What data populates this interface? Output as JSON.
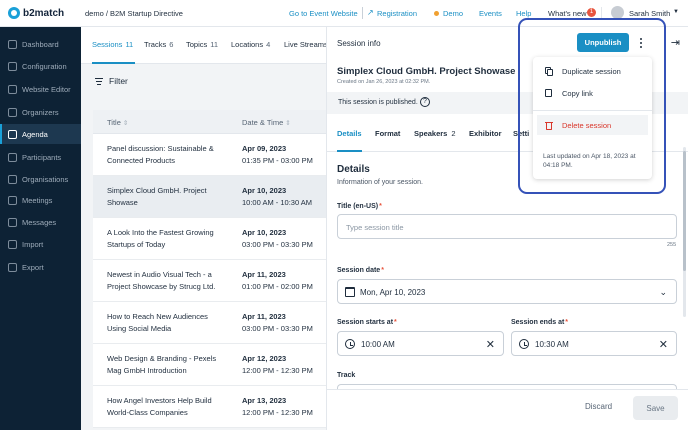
{
  "topbar": {
    "logo": "b2match",
    "breadcrumb": "demo / B2M Startup Directive",
    "links": {
      "go_to_event": "Go to Event Website",
      "registration": "Registration",
      "demo": "Demo",
      "events": "Events",
      "help": "Help",
      "whats_new": "What's new",
      "whats_new_count": "1"
    },
    "user": "Sarah Smith"
  },
  "sidebar": {
    "items": [
      {
        "label": "Dashboard",
        "icon": "dashboard-icon"
      },
      {
        "label": "Configuration",
        "icon": "gear-icon"
      },
      {
        "label": "Website Editor",
        "icon": "page-icon"
      },
      {
        "label": "Organizers",
        "icon": "user-icon"
      },
      {
        "label": "Agenda",
        "icon": "calendar-icon"
      },
      {
        "label": "Participants",
        "icon": "people-icon"
      },
      {
        "label": "Organisations",
        "icon": "building-icon"
      },
      {
        "label": "Meetings",
        "icon": "meeting-icon"
      },
      {
        "label": "Messages",
        "icon": "message-icon"
      },
      {
        "label": "Import",
        "icon": "import-icon"
      },
      {
        "label": "Export",
        "icon": "export-icon"
      }
    ],
    "active": "Agenda"
  },
  "list": {
    "tabs": [
      {
        "label": "Sessions",
        "count": "11"
      },
      {
        "label": "Tracks",
        "count": "6"
      },
      {
        "label": "Topics",
        "count": "11"
      },
      {
        "label": "Locations",
        "count": "4"
      },
      {
        "label": "Live Streams",
        "count": ""
      }
    ],
    "filter_label": "Filter",
    "columns": [
      "Title",
      "Date & Time"
    ],
    "rows": [
      {
        "title": "Panel discussion: Sustainable & Connected Products",
        "date": "Apr 09, 2023",
        "time": "01:35 PM - 03:00 PM"
      },
      {
        "title": "Simplex Cloud GmbH. Project Showase",
        "date": "Apr 10, 2023",
        "time": "10:00 AM - 10:30 AM"
      },
      {
        "title": "A Look Into the Fastest Growing Startups of Today",
        "date": "Apr 10, 2023",
        "time": "03:00 PM - 03:30 PM"
      },
      {
        "title": "Newest in Audio Visual Tech - a Project Showcase by Strucg Ltd.",
        "date": "Apr 11, 2023",
        "time": "01:00 PM - 02:00 PM"
      },
      {
        "title": "How to Reach New Audiences Using Social Media",
        "date": "Apr 11, 2023",
        "time": "03:00 PM - 03:30 PM"
      },
      {
        "title": "Web Design & Branding - Pexels Mag GmbH Introduction",
        "date": "Apr 12, 2023",
        "time": "12:00 PM - 12:30 PM"
      },
      {
        "title": "How Angel Investors Help Build World-Class Companies",
        "date": "Apr 13, 2023",
        "time": "12:00 PM - 12:30 PM"
      }
    ]
  },
  "detail": {
    "header": "Session info",
    "unpublish_label": "Unpublish",
    "title": "Simplex Cloud GmbH. Project Showase",
    "created": "Created on Jan 26, 2023 at 02:32 PM.",
    "published_note": "This session is published.",
    "tabs": [
      {
        "label": "Details",
        "count": ""
      },
      {
        "label": "Format",
        "count": ""
      },
      {
        "label": "Speakers",
        "count": "2"
      },
      {
        "label": "Exhibitor",
        "count": ""
      },
      {
        "label": "Setti",
        "count": ""
      }
    ],
    "section_title": "Details",
    "section_sub": "Information of your session.",
    "fields": {
      "title_label": "Title (en-US)",
      "title_placeholder": "Type session title",
      "title_count": "255",
      "date_label": "Session date",
      "date_value": "Mon, Apr 10, 2023",
      "start_label": "Session starts at",
      "start_value": "10:00 AM",
      "end_label": "Session ends at",
      "end_value": "10:30 AM",
      "track_label": "Track"
    },
    "discard_label": "Discard",
    "save_label": "Save"
  },
  "menu": {
    "items": [
      {
        "label": "Duplicate session",
        "icon": "duplicate-icon"
      },
      {
        "label": "Copy link",
        "icon": "copy-link-icon"
      },
      {
        "label": "Delete session",
        "icon": "trash-icon"
      }
    ],
    "footer": "Last updated on Apr 18, 2023 at 04:18 PM."
  },
  "colors": {
    "accent": "#1a8fc4",
    "sidebar_bg": "#0d2235",
    "danger": "#d9362b",
    "highlight": "#3552b8"
  }
}
